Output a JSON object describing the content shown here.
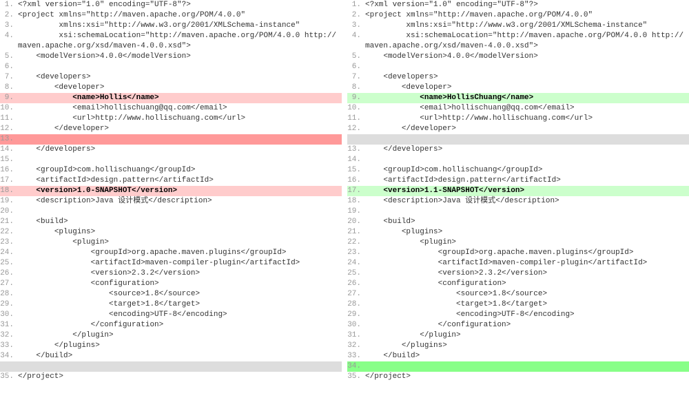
{
  "left": [
    {
      "n": "1.",
      "text": "<?xml version=\"1.0\" encoding=\"UTF-8\"?>"
    },
    {
      "n": "2.",
      "text": "<project xmlns=\"http://maven.apache.org/POM/4.0.0\""
    },
    {
      "n": "3.",
      "text": "         xmlns:xsi=\"http://www.w3.org/2001/XMLSchema-instance\""
    },
    {
      "n": "4.",
      "text": "         xsi:schemaLocation=\"http://maven.apache.org/POM/4.0.0 http://maven.apache.org/xsd/maven-4.0.0.xsd\">"
    },
    {
      "n": "5.",
      "text": "    <modelVersion>4.0.0</modelVersion>"
    },
    {
      "n": "6.",
      "text": ""
    },
    {
      "n": "7.",
      "text": "    <developers>"
    },
    {
      "n": "8.",
      "text": "        <developer>"
    },
    {
      "n": "9.",
      "text": "            <name>Hollis</name>",
      "hl": "del",
      "bold": true
    },
    {
      "n": "10.",
      "text": "            <email>hollischuang@qq.com</email>"
    },
    {
      "n": "11.",
      "text": "            <url>http://www.hollischuang.com</url>"
    },
    {
      "n": "12.",
      "text": "        </developer>"
    },
    {
      "n": "13.",
      "text": "",
      "hl": "del-strong"
    },
    {
      "n": "14.",
      "text": "    </developers>"
    },
    {
      "n": "15.",
      "text": ""
    },
    {
      "n": "16.",
      "text": "    <groupId>com.hollischuang</groupId>"
    },
    {
      "n": "17.",
      "text": "    <artifactId>design.pattern</artifactId>"
    },
    {
      "n": "18.",
      "text": "    <version>1.0-SNAPSHOT</version>",
      "hl": "del",
      "bold": true
    },
    {
      "n": "19.",
      "text": "    <description>Java 设计模式</description>"
    },
    {
      "n": "20.",
      "text": ""
    },
    {
      "n": "21.",
      "text": "    <build>"
    },
    {
      "n": "22.",
      "text": "        <plugins>"
    },
    {
      "n": "23.",
      "text": "            <plugin>"
    },
    {
      "n": "24.",
      "text": "                <groupId>org.apache.maven.plugins</groupId>"
    },
    {
      "n": "25.",
      "text": "                <artifactId>maven-compiler-plugin</artifactId>"
    },
    {
      "n": "26.",
      "text": "                <version>2.3.2</version>"
    },
    {
      "n": "27.",
      "text": "                <configuration>"
    },
    {
      "n": "28.",
      "text": "                    <source>1.8</source>"
    },
    {
      "n": "29.",
      "text": "                    <target>1.8</target>"
    },
    {
      "n": "30.",
      "text": "                    <encoding>UTF-8</encoding>"
    },
    {
      "n": "31.",
      "text": "                </configuration>"
    },
    {
      "n": "32.",
      "text": "            </plugin>"
    },
    {
      "n": "33.",
      "text": "        </plugins>"
    },
    {
      "n": "34.",
      "text": "    </build>"
    },
    {
      "n": "",
      "text": "",
      "hl": "context"
    },
    {
      "n": "35.",
      "text": "</project>"
    }
  ],
  "right": [
    {
      "n": "1.",
      "text": "<?xml version=\"1.0\" encoding=\"UTF-8\"?>"
    },
    {
      "n": "2.",
      "text": "<project xmlns=\"http://maven.apache.org/POM/4.0.0\""
    },
    {
      "n": "3.",
      "text": "         xmlns:xsi=\"http://www.w3.org/2001/XMLSchema-instance\""
    },
    {
      "n": "4.",
      "text": "         xsi:schemaLocation=\"http://maven.apache.org/POM/4.0.0 http://maven.apache.org/xsd/maven-4.0.0.xsd\">"
    },
    {
      "n": "5.",
      "text": "    <modelVersion>4.0.0</modelVersion>"
    },
    {
      "n": "6.",
      "text": ""
    },
    {
      "n": "7.",
      "text": "    <developers>"
    },
    {
      "n": "8.",
      "text": "        <developer>"
    },
    {
      "n": "9.",
      "text": "            <name>HollisChuang</name>",
      "hl": "add",
      "bold": true
    },
    {
      "n": "10.",
      "text": "            <email>hollischuang@qq.com</email>"
    },
    {
      "n": "11.",
      "text": "            <url>http://www.hollischuang.com</url>"
    },
    {
      "n": "12.",
      "text": "        </developer>"
    },
    {
      "n": "",
      "text": "",
      "hl": "context"
    },
    {
      "n": "13.",
      "text": "    </developers>"
    },
    {
      "n": "14.",
      "text": ""
    },
    {
      "n": "15.",
      "text": "    <groupId>com.hollischuang</groupId>"
    },
    {
      "n": "16.",
      "text": "    <artifactId>design.pattern</artifactId>"
    },
    {
      "n": "17.",
      "text": "    <version>1.1-SNAPSHOT</version>",
      "hl": "add",
      "bold": true
    },
    {
      "n": "18.",
      "text": "    <description>Java 设计模式</description>"
    },
    {
      "n": "19.",
      "text": ""
    },
    {
      "n": "20.",
      "text": "    <build>"
    },
    {
      "n": "21.",
      "text": "        <plugins>"
    },
    {
      "n": "22.",
      "text": "            <plugin>"
    },
    {
      "n": "23.",
      "text": "                <groupId>org.apache.maven.plugins</groupId>"
    },
    {
      "n": "24.",
      "text": "                <artifactId>maven-compiler-plugin</artifactId>"
    },
    {
      "n": "25.",
      "text": "                <version>2.3.2</version>"
    },
    {
      "n": "26.",
      "text": "                <configuration>"
    },
    {
      "n": "27.",
      "text": "                    <source>1.8</source>"
    },
    {
      "n": "28.",
      "text": "                    <target>1.8</target>"
    },
    {
      "n": "29.",
      "text": "                    <encoding>UTF-8</encoding>"
    },
    {
      "n": "30.",
      "text": "                </configuration>"
    },
    {
      "n": "31.",
      "text": "            </plugin>"
    },
    {
      "n": "32.",
      "text": "        </plugins>"
    },
    {
      "n": "33.",
      "text": "    </build>"
    },
    {
      "n": "34.",
      "text": "",
      "hl": "add-strong"
    },
    {
      "n": "35.",
      "text": "</project>"
    }
  ]
}
